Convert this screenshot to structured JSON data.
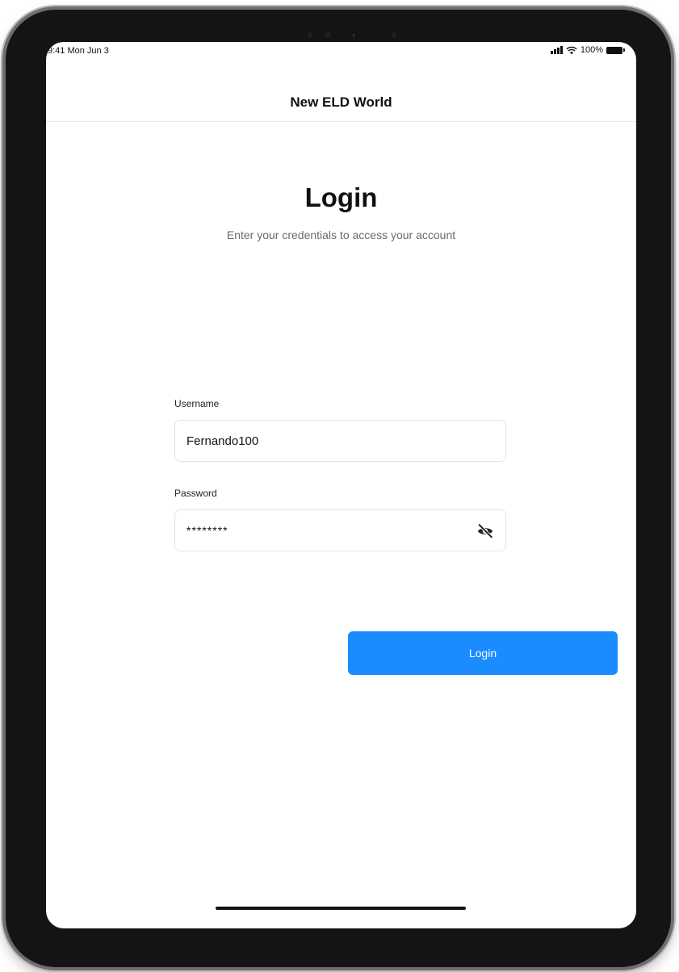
{
  "status_bar": {
    "time": "9:41 Mon Jun 3",
    "battery": "100%"
  },
  "nav": {
    "title": "New ELD World"
  },
  "login": {
    "heading": "Login",
    "subheading": "Enter your credentials to access your account",
    "username_label": "Username",
    "username_value": "Fernando100",
    "password_label": "Password",
    "password_value": "********",
    "submit_label": "Login"
  },
  "icons": {
    "password_toggle": "eye-off-icon",
    "signal": "cellular-signal-icon",
    "wifi": "wifi-icon",
    "battery": "battery-icon"
  },
  "colors": {
    "primary_button": "#1a8cff",
    "device_frame": "#141414"
  }
}
